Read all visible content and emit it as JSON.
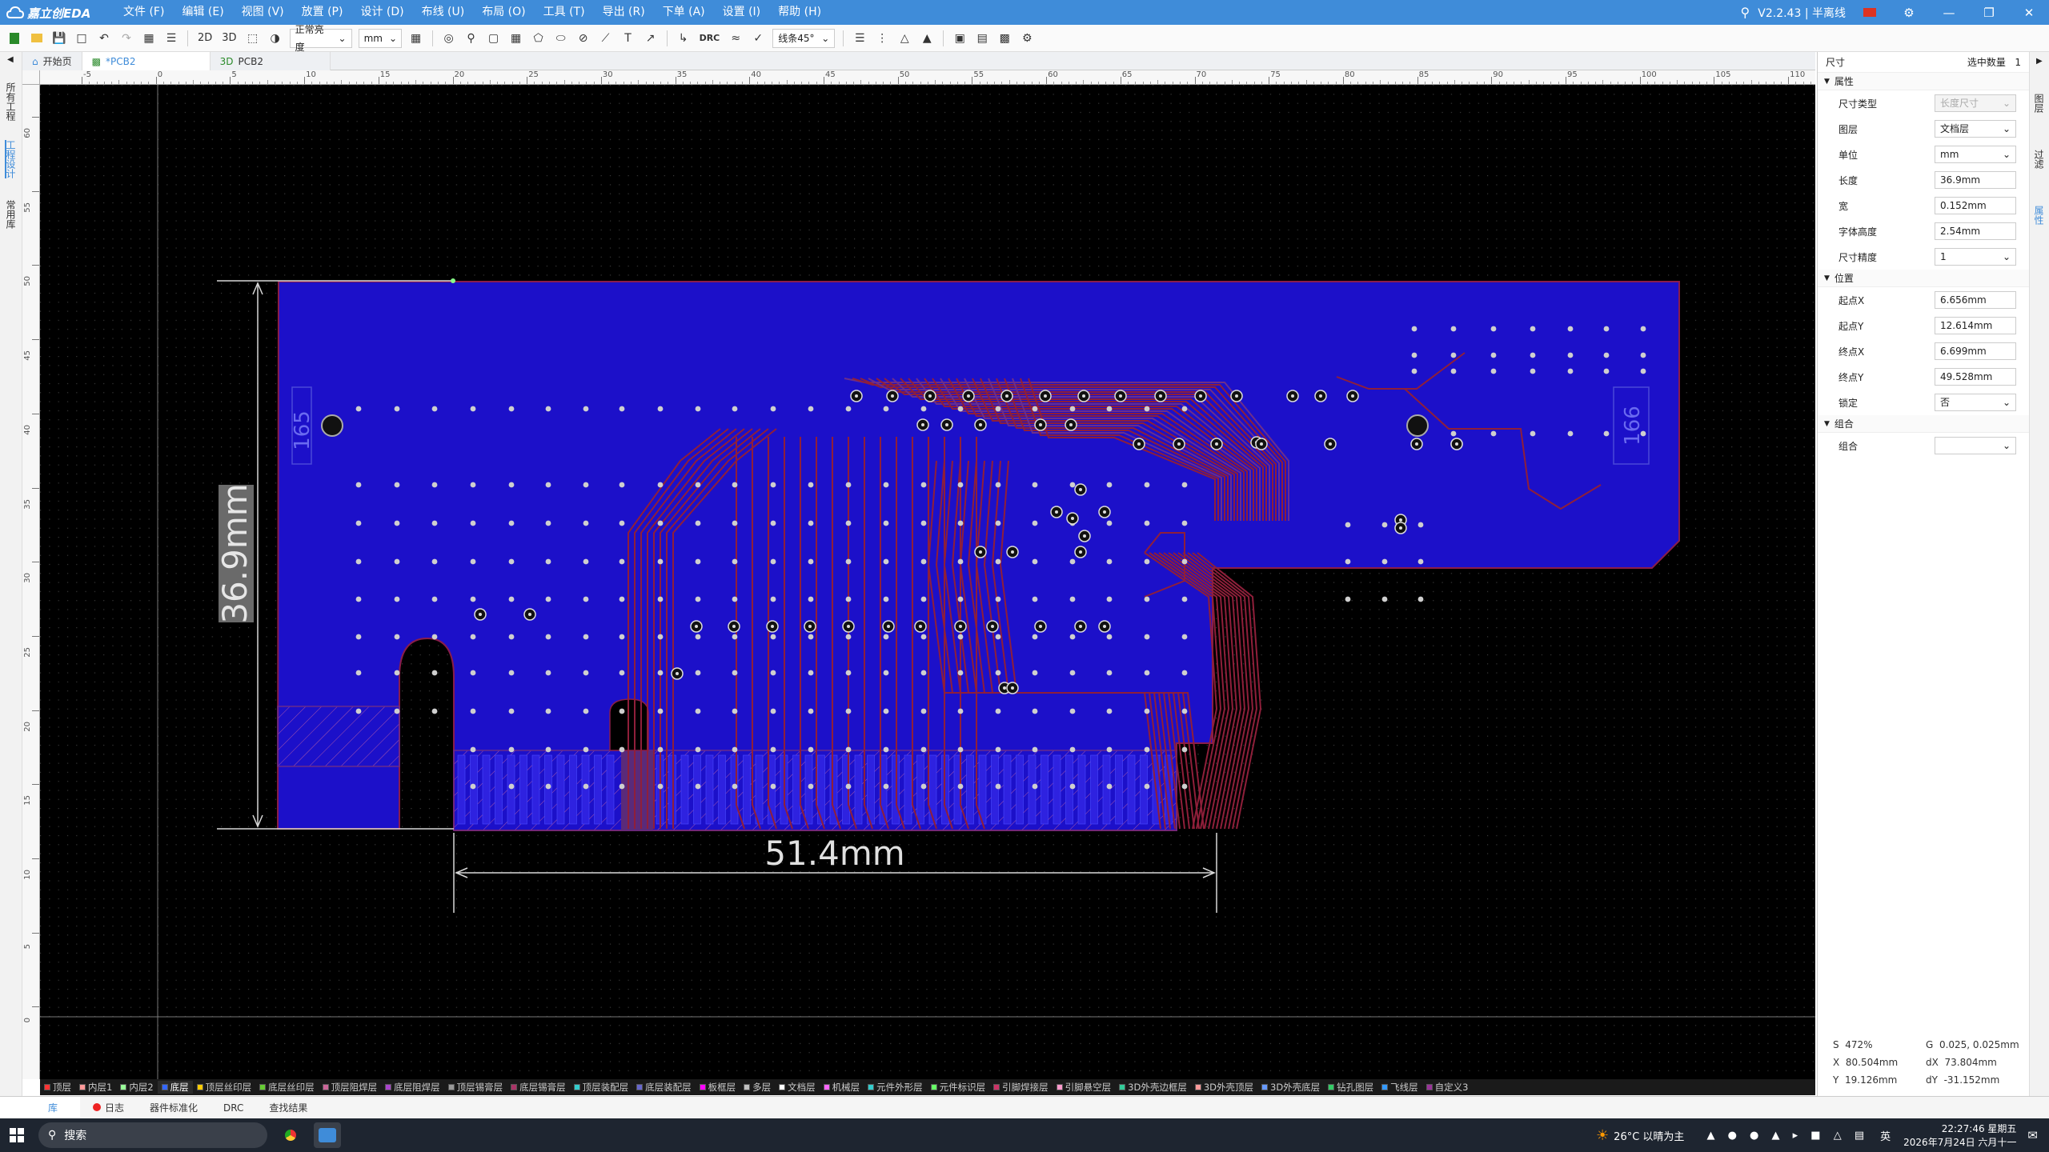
{
  "app": {
    "logo_text": "嘉立创EDA",
    "version_text": "V2.2.43 | 半离线",
    "menu": [
      "文件 (F)",
      "编辑 (E)",
      "视图 (V)",
      "放置 (P)",
      "设计 (D)",
      "布线 (U)",
      "布局 (O)",
      "工具 (T)",
      "导出 (R)",
      "下单 (A)",
      "设置 (I)",
      "帮助 (H)"
    ]
  },
  "toolbar": {
    "view2d": "2D",
    "view3d": "3D",
    "brightness": "正常亮度",
    "unit": "mm",
    "drc": "DRC",
    "route_angle": "线条45°"
  },
  "left_tabs": [
    "所有工程",
    "工程设计",
    "常用库"
  ],
  "doc_tabs": [
    {
      "label": "开始页",
      "active": false
    },
    {
      "label": "*PCB2",
      "active": true
    },
    {
      "label": "PCB2",
      "active": false
    }
  ],
  "ruler": {
    "h_ticks": [
      "-5",
      "0",
      "5",
      "10",
      "15",
      "20",
      "25",
      "30",
      "35",
      "40",
      "45",
      "50",
      "55",
      "60",
      "65",
      "70",
      "75",
      "80",
      "85",
      "90",
      "95",
      "100",
      "105",
      "110"
    ],
    "v_ticks": [
      "60",
      "55",
      "50",
      "45",
      "40",
      "35",
      "30",
      "25",
      "20",
      "15",
      "10",
      "5",
      "0"
    ]
  },
  "pcb": {
    "dim_vertical": "36.9mm",
    "dim_horizontal": "51.4mm",
    "left_label": "165",
    "right_label": "166",
    "colors": {
      "board": "#1c10c9",
      "trace": "#8f1f3a",
      "pad": "#c9c9c9",
      "edge": "#8a1d4a",
      "dim": "#d8d8d8"
    }
  },
  "layers": [
    {
      "name": "顶层",
      "color": "#ff3333"
    },
    {
      "name": "内层1",
      "color": "#ff9999"
    },
    {
      "name": "内层2",
      "color": "#99ff99"
    },
    {
      "name": "底层",
      "color": "#3366ff"
    },
    {
      "name": "顶层丝印层",
      "color": "#ffcc00"
    },
    {
      "name": "底层丝印层",
      "color": "#66cc33"
    },
    {
      "name": "顶层阻焊层",
      "color": "#cc6699"
    },
    {
      "name": "底层阻焊层",
      "color": "#aa44cc"
    },
    {
      "name": "顶层锡膏层",
      "color": "#999999"
    },
    {
      "name": "底层锡膏层",
      "color": "#aa3366"
    },
    {
      "name": "顶层装配层",
      "color": "#33cccc"
    },
    {
      "name": "底层装配层",
      "color": "#6666cc"
    },
    {
      "name": "板框层",
      "color": "#ff00ff"
    },
    {
      "name": "多层",
      "color": "#c0c0c0"
    },
    {
      "name": "文档层",
      "color": "#ffffff"
    },
    {
      "name": "机械层",
      "color": "#ff66ff"
    },
    {
      "name": "元件外形层",
      "color": "#33cccc"
    },
    {
      "name": "元件标识层",
      "color": "#66ff66"
    },
    {
      "name": "引脚焊接层",
      "color": "#cc3366"
    },
    {
      "name": "引脚悬空层",
      "color": "#ff99cc"
    },
    {
      "name": "3D外壳边框层",
      "color": "#33cc99"
    },
    {
      "name": "3D外壳顶层",
      "color": "#ff9999"
    },
    {
      "name": "3D外壳底层",
      "color": "#6699ff"
    },
    {
      "name": "钻孔图层",
      "color": "#33cc66"
    },
    {
      "name": "飞线层",
      "color": "#3399ff"
    },
    {
      "name": "自定义3",
      "color": "#993399"
    }
  ],
  "panel": {
    "title": "尺寸",
    "selected_count_label": "选中数量",
    "selected_count": "1",
    "sections": {
      "props": "属性",
      "position": "位置",
      "group": "组合"
    },
    "props": [
      {
        "label": "尺寸类型",
        "value": "长度尺寸",
        "type": "select",
        "disabled": true
      },
      {
        "label": "图层",
        "value": "文档层",
        "type": "select",
        "disabled": false
      },
      {
        "label": "单位",
        "value": "mm",
        "type": "select",
        "disabled": false
      },
      {
        "label": "长度",
        "value": "36.9mm",
        "type": "input",
        "disabled": false
      },
      {
        "label": "宽",
        "value": "0.152mm",
        "type": "input",
        "disabled": false
      },
      {
        "label": "字体高度",
        "value": "2.54mm",
        "type": "input",
        "disabled": false
      },
      {
        "label": "尺寸精度",
        "value": "1",
        "type": "select",
        "disabled": false
      }
    ],
    "position": [
      {
        "label": "起点X",
        "value": "6.656mm",
        "type": "input"
      },
      {
        "label": "起点Y",
        "value": "12.614mm",
        "type": "input"
      },
      {
        "label": "终点X",
        "value": "6.699mm",
        "type": "input"
      },
      {
        "label": "终点Y",
        "value": "49.528mm",
        "type": "input"
      },
      {
        "label": "锁定",
        "value": "否",
        "type": "select"
      }
    ],
    "group": [
      {
        "label": "组合",
        "value": "",
        "type": "select"
      }
    ],
    "right_tabs": [
      "图层",
      "过滤",
      "属性"
    ]
  },
  "status": {
    "s_label": "S",
    "s_value": "472%",
    "g_label": "G",
    "g_value": "0.025, 0.025mm",
    "x_label": "X",
    "x_value": "80.504mm",
    "dx_label": "dX",
    "dx_value": "73.804mm",
    "y_label": "Y",
    "y_value": "19.126mm",
    "dy_label": "dY",
    "dy_value": "-31.152mm"
  },
  "bottom_tabs": [
    {
      "label": "库",
      "active": true
    },
    {
      "label": "日志",
      "active": false
    },
    {
      "label": "器件标准化",
      "active": false
    },
    {
      "label": "DRC",
      "active": false
    },
    {
      "label": "查找结果",
      "active": false
    }
  ],
  "taskbar": {
    "search": "搜索",
    "weather": "26°C 以晴为主",
    "lang": "英",
    "time": "22:27:46 星期五",
    "date": "2026年7月24日 六月十一"
  }
}
